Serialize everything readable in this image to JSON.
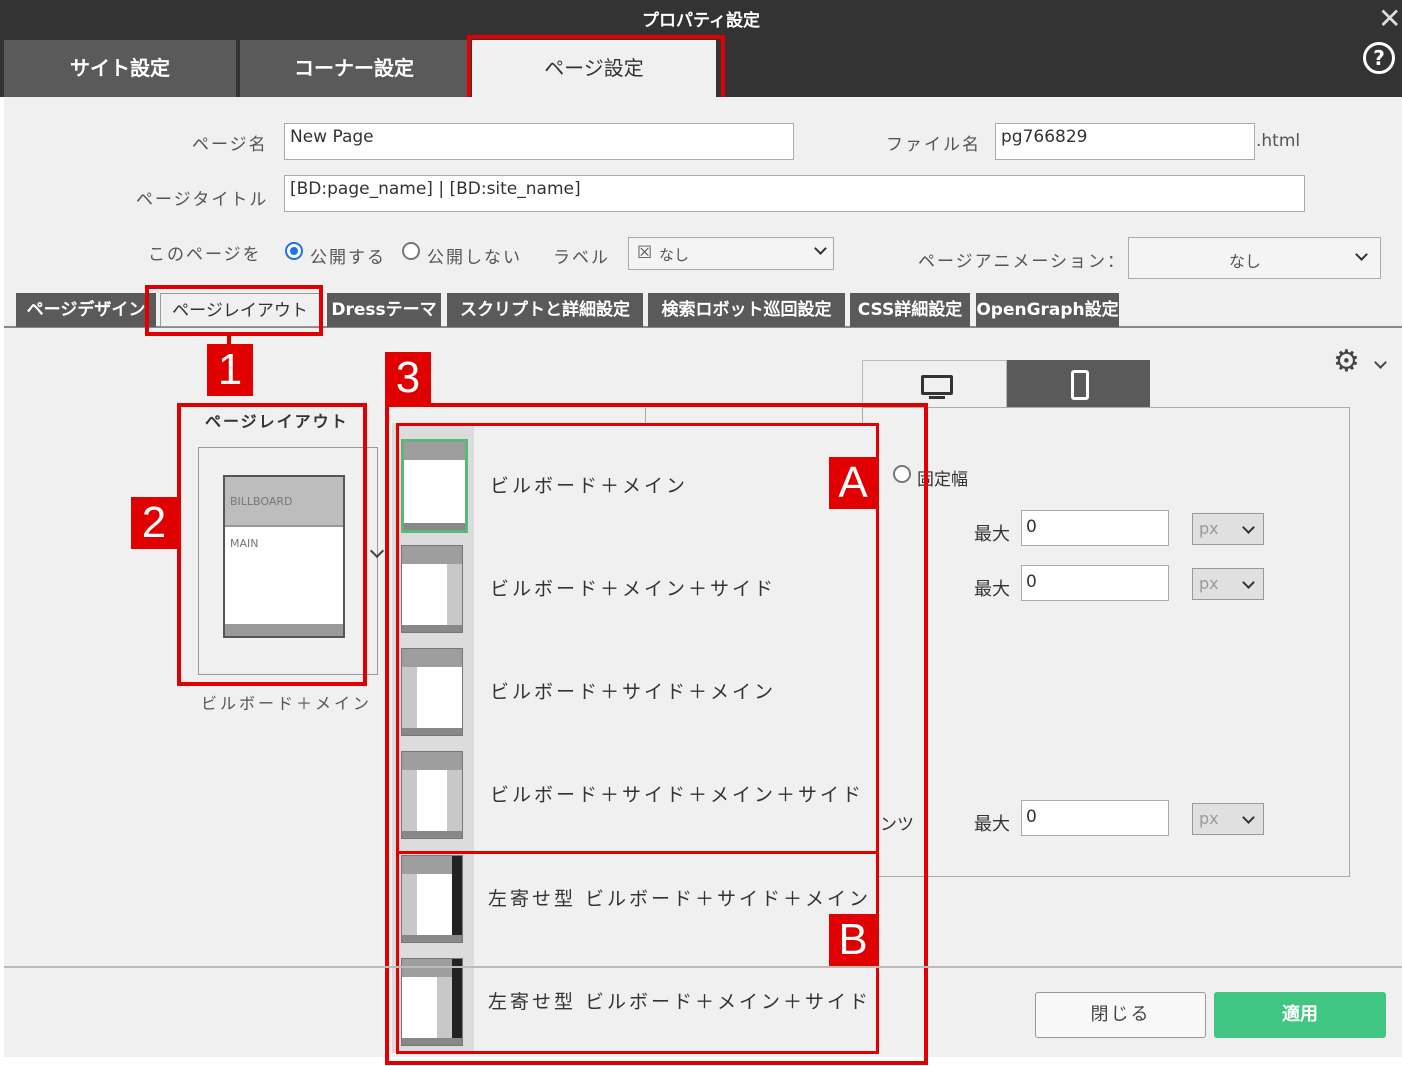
{
  "window": {
    "title": "プロパティ設定"
  },
  "main_tabs": [
    {
      "label": "サイト設定"
    },
    {
      "label": "コーナー設定"
    },
    {
      "label": "ページ設定"
    }
  ],
  "form": {
    "page_name_label": "ページ名",
    "page_name_value": "New Page",
    "file_name_label": "ファイル名",
    "file_name_value": "pg766829",
    "file_ext": ".html",
    "page_title_label": "ページタイトル",
    "page_title_value": "[BD:page_name] | [BD:site_name]",
    "visibility_label": "このページを",
    "publish_label": "公開する",
    "unpublish_label": "公開しない",
    "label_label": "ラベル",
    "label_value": "なし",
    "animation_label": "ページアニメーション：",
    "animation_value": "なし"
  },
  "sub_tabs": [
    {
      "label": "ページデザイン"
    },
    {
      "label": "ページレイアウト"
    },
    {
      "label": "Dressテーマ"
    },
    {
      "label": "スクリプトと詳細設定"
    },
    {
      "label": "検索ロボット巡回設定"
    },
    {
      "label": "CSS詳細設定"
    },
    {
      "label": "OpenGraph設定"
    }
  ],
  "layout": {
    "heading": "ページレイアウト",
    "thumb_billboard": "BILLBOARD",
    "thumb_main": "MAIN",
    "current_name": "ビルボード＋メイン"
  },
  "layout_options": [
    {
      "label": "ビルボード＋メイン"
    },
    {
      "label": "ビルボード＋メイン＋サイド"
    },
    {
      "label": "ビルボード＋サイド＋メイン"
    },
    {
      "label": "ビルボード＋サイド＋メイン＋サイド"
    },
    {
      "label": "左寄せ型 ビルボード＋サイド＋メイン"
    },
    {
      "label": "左寄せ型 ビルボード＋メイン＋サイド"
    }
  ],
  "annotations": {
    "badge_1": "1",
    "badge_2": "2",
    "badge_3": "3",
    "badge_a": "A",
    "badge_b": "B"
  },
  "right_panel": {
    "fixed_width_label": "固定幅",
    "contents_fragment": "ンツ",
    "max_label": "最大",
    "rows": [
      {
        "value": "0",
        "unit": "px"
      },
      {
        "value": "0",
        "unit": "px"
      },
      {
        "value": "0",
        "unit": "px"
      }
    ]
  },
  "buttons": {
    "close": "閉じる",
    "apply": "適用"
  },
  "colors": {
    "annotation_red": "#e00000",
    "apply_green": "#40c682",
    "header_dark": "#333333"
  }
}
